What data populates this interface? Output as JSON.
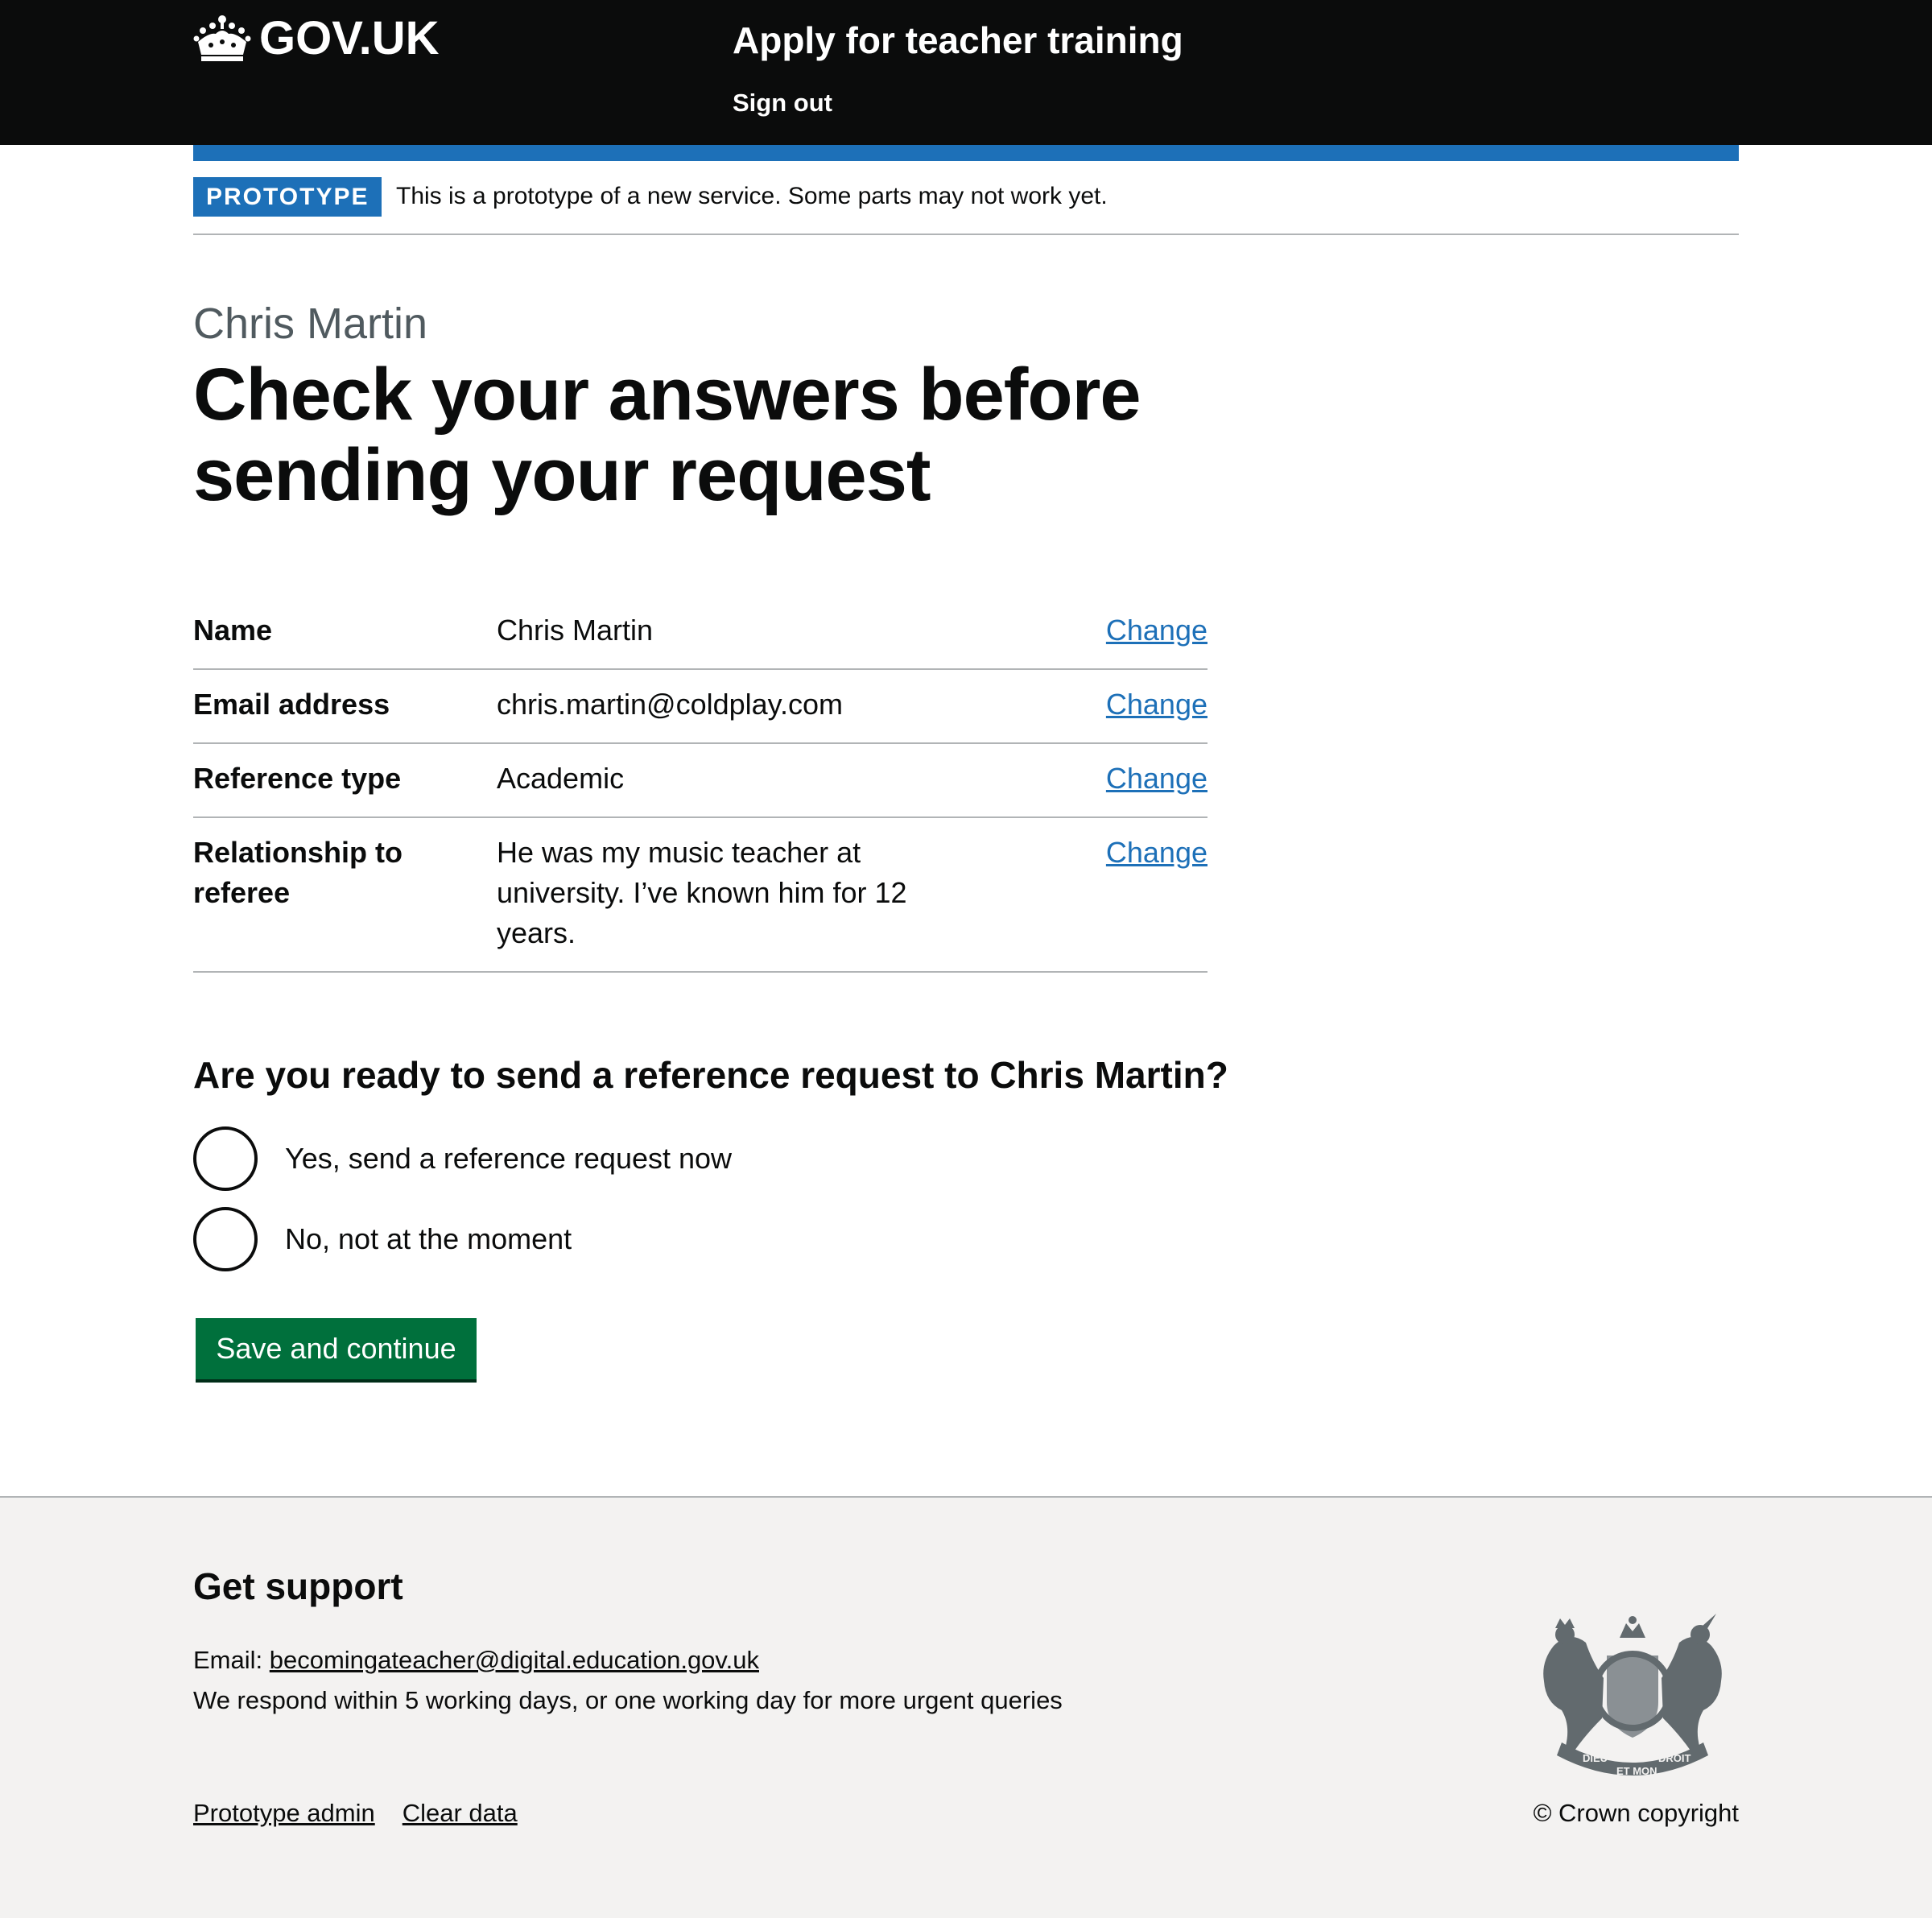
{
  "header": {
    "logo_text": "GOV.UK",
    "service_name": "Apply for teacher training",
    "sign_out": "Sign out"
  },
  "phase": {
    "tag": "PROTOTYPE",
    "text": "This is a prototype of a new service. Some parts may not work yet."
  },
  "main": {
    "caption": "Chris Martin",
    "heading": "Check your answers before sending your request",
    "summary": [
      {
        "key": "Name",
        "value": "Chris Martin",
        "action": "Change"
      },
      {
        "key": "Email address",
        "value": "chris.martin@coldplay.com",
        "action": "Change"
      },
      {
        "key": "Reference type",
        "value": "Academic",
        "action": "Change"
      },
      {
        "key": "Relationship to referee",
        "value": "He was my music teacher at university. I’ve known him for 12 years.",
        "action": "Change"
      }
    ],
    "question": "Are you ready to send a reference request to Chris Martin?",
    "options": [
      "Yes, send a reference request now",
      "No, not at the moment"
    ],
    "button": "Save and continue"
  },
  "footer": {
    "heading": "Get support",
    "email_label": "Email: ",
    "email_address": "becomingateacher@digital.education.gov.uk",
    "respond_text": "We respond within 5 working days, or one working day for more urgent queries",
    "links": [
      "Prototype admin",
      "Clear data"
    ],
    "copyright": "© Crown copyright",
    "crest_motto": [
      "DIEU",
      "ET MON",
      "DROIT"
    ]
  },
  "colors": {
    "header_bg": "#0b0c0c",
    "brand_blue": "#1d70b8",
    "link": "#1d70b8",
    "button_green": "#00703c",
    "footer_bg": "#f3f2f1",
    "secondary_text": "#505a5f"
  }
}
